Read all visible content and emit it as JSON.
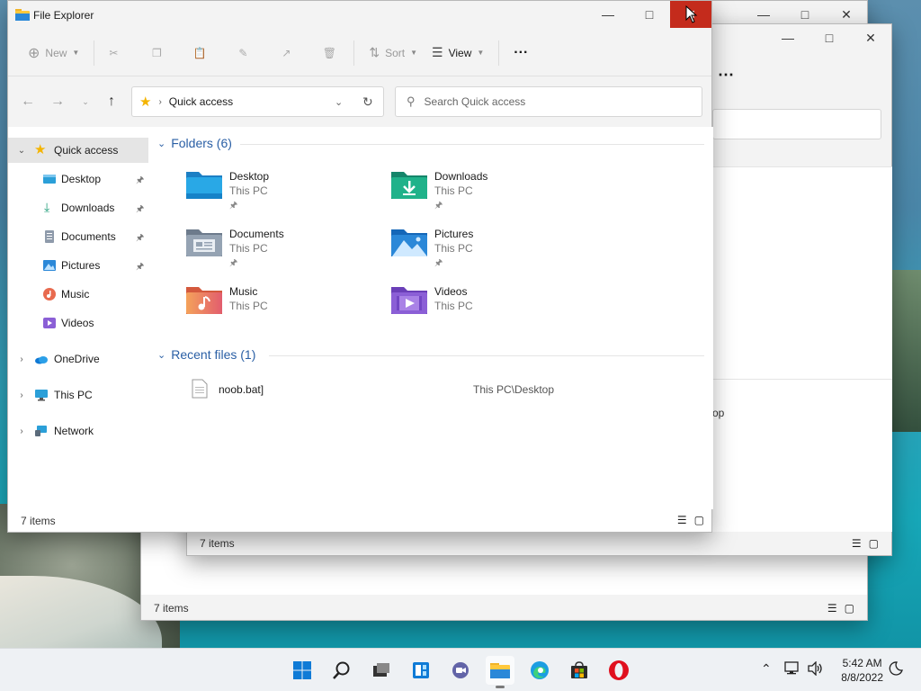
{
  "main_window": {
    "title": "File Explorer",
    "toolbar": {
      "new_label": "New",
      "sort_label": "Sort",
      "view_label": "View",
      "more_label": "···"
    },
    "address": {
      "location": "Quick access",
      "search_placeholder": "Search Quick access"
    },
    "sidebar": {
      "items": [
        {
          "label": "Quick access",
          "icon": "star-icon"
        },
        {
          "label": "Desktop",
          "icon": "desktop-folder-icon"
        },
        {
          "label": "Downloads",
          "icon": "download-icon"
        },
        {
          "label": "Documents",
          "icon": "documents-icon"
        },
        {
          "label": "Pictures",
          "icon": "pictures-icon"
        },
        {
          "label": "Music",
          "icon": "music-icon"
        },
        {
          "label": "Videos",
          "icon": "videos-icon"
        },
        {
          "label": "OneDrive",
          "icon": "cloud-icon"
        },
        {
          "label": "This PC",
          "icon": "monitor-icon"
        },
        {
          "label": "Network",
          "icon": "network-icon"
        }
      ]
    },
    "content": {
      "folders_header": "Folders (6)",
      "folders": [
        {
          "name": "Desktop",
          "location": "This PC",
          "pinned": true
        },
        {
          "name": "Downloads",
          "location": "This PC",
          "pinned": true
        },
        {
          "name": "Documents",
          "location": "This PC",
          "pinned": true
        },
        {
          "name": "Pictures",
          "location": "This PC",
          "pinned": true
        },
        {
          "name": "Music",
          "location": "This PC",
          "pinned": false
        },
        {
          "name": "Videos",
          "location": "This PC",
          "pinned": false
        }
      ],
      "recent_header": "Recent files (1)",
      "recent_files": [
        {
          "name": "noob.bat]",
          "path": "This PC\\Desktop"
        }
      ]
    },
    "status": "7 items"
  },
  "back_windows": {
    "window1": {
      "status": "7 items",
      "partial_text": "op"
    },
    "window2": {
      "status": "7 items"
    }
  },
  "taskbar": {
    "apps": [
      "start-icon",
      "search-icon",
      "task-view-icon",
      "widgets-icon",
      "chat-icon",
      "file-explorer-icon",
      "edge-icon",
      "store-icon",
      "opera-icon"
    ],
    "time": "5:42 AM",
    "date": "8/8/2022"
  },
  "colors": {
    "accent_blue": "#2a5fa5",
    "close_red": "#c42b1c",
    "selection_gray": "#e5e5e5"
  }
}
